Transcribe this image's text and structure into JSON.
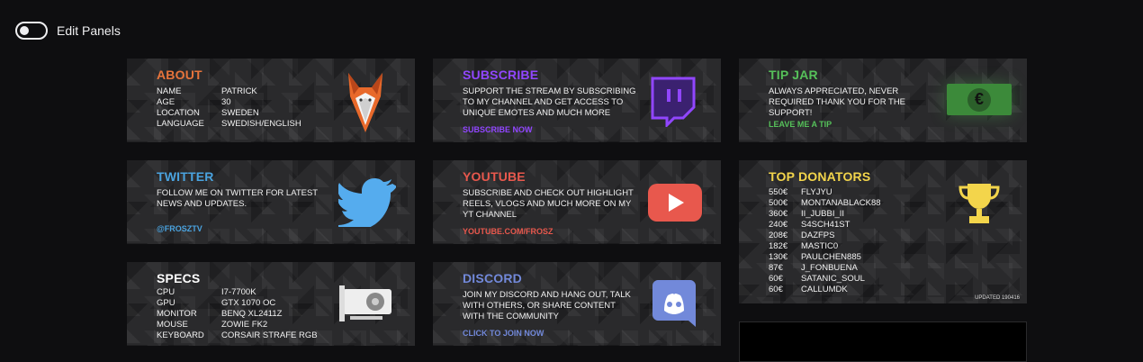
{
  "toggle": {
    "label": "Edit Panels"
  },
  "colors": {
    "about": "#e8743b",
    "subscribe": "#9146ff",
    "tip": "#56c15a",
    "twitter": "#4aa3df",
    "youtube": "#e8584d",
    "specs": "#ffffff",
    "discord": "#7289da",
    "donators": "#f3d54b"
  },
  "about": {
    "title": "ABOUT",
    "rows": [
      {
        "k": "NAME",
        "v": "PATRICK"
      },
      {
        "k": "AGE",
        "v": "30"
      },
      {
        "k": "LOCATION",
        "v": "SWEDEN"
      },
      {
        "k": "LANGUAGE",
        "v": "SWEDISH/ENGLISH"
      }
    ],
    "icon": "fox-icon"
  },
  "subscribe": {
    "title": "SUBSCRIBE",
    "text": "SUPPORT THE STREAM BY SUBSCRIBING TO MY CHANNEL AND GET ACCESS TO UNIQUE EMOTES AND MUCH MORE",
    "cta": "SUBSCRIBE NOW",
    "icon": "twitch-icon"
  },
  "tip": {
    "title": "TIP JAR",
    "text": "ALWAYS APPRECIATED, NEVER REQUIRED THANK YOU FOR THE SUPPORT!",
    "cta": "LEAVE ME A TIP",
    "icon": "euro-banknote-icon",
    "symbol": "€"
  },
  "twitter": {
    "title": "TWITTER",
    "text": "FOLLOW ME ON TWITTER FOR LATEST NEWS AND UPDATES.",
    "cta": "@FROSZTV",
    "icon": "twitter-bird-icon"
  },
  "youtube": {
    "title": "YOUTUBE",
    "text": "SUBSCRIBE AND CHECK OUT HIGHLIGHT REELS, VLOGS AND MUCH MORE ON MY YT CHANNEL",
    "cta": "YOUTUBE.COM/FROSZ",
    "icon": "youtube-play-icon"
  },
  "donators": {
    "title": "TOP DONATORS",
    "list": [
      {
        "amount": "550€",
        "name": "FLYJYU"
      },
      {
        "amount": "500€",
        "name": "MONTANABLACK88"
      },
      {
        "amount": "360€",
        "name": "II_JUBBI_II"
      },
      {
        "amount": "240€",
        "name": "S4SCH41ST"
      },
      {
        "amount": "208€",
        "name": "DAZFPS"
      },
      {
        "amount": "182€",
        "name": "MASTIC0"
      },
      {
        "amount": "130€",
        "name": "PAULCHEN885"
      },
      {
        "amount": "87€",
        "name": "J_FONBUENA"
      },
      {
        "amount": "60€",
        "name": "SATANIC_SOUL"
      },
      {
        "amount": "60€",
        "name": "CALLUMDK"
      }
    ],
    "updated": "UPDATED 190416",
    "icon": "trophy-icon"
  },
  "specs": {
    "title": "SPECS",
    "rows": [
      {
        "k": "CPU",
        "v": "I7-7700K"
      },
      {
        "k": "GPU",
        "v": "GTX 1070 OC"
      },
      {
        "k": "MONITOR",
        "v": "BENQ XL2411Z"
      },
      {
        "k": "MOUSE",
        "v": "ZOWIE FK2"
      },
      {
        "k": "KEYBOARD",
        "v": "CORSAIR STRAFE RGB"
      }
    ],
    "icon": "graphics-card-icon"
  },
  "discord": {
    "title": "DISCORD",
    "text": "JOIN MY DISCORD AND HANG OUT, TALK WITH OTHERS, OR SHARE CONTENT WITH THE COMMUNITY",
    "cta": "CLICK TO JOIN NOW",
    "icon": "discord-icon"
  }
}
